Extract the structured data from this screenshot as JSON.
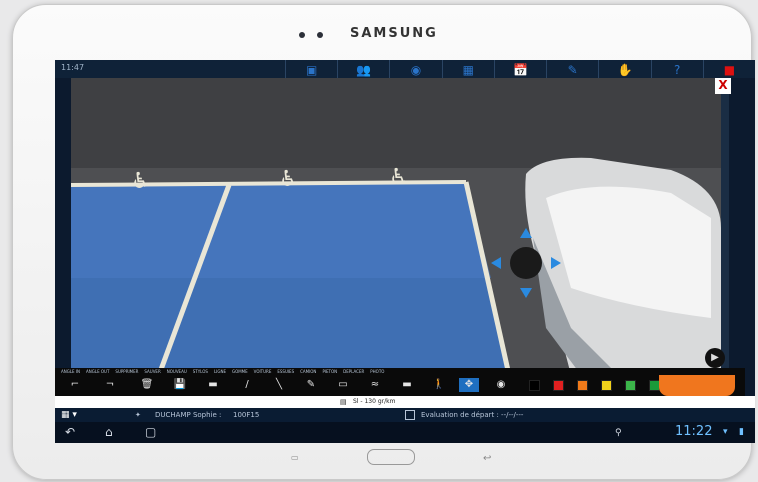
{
  "device": {
    "brand": "SAMSUNG"
  },
  "status_bar": {
    "time": "11:47"
  },
  "top_toolbar": {
    "buttons": [
      {
        "name": "fullscreen",
        "icon": "fullscreen-icon"
      },
      {
        "name": "users",
        "icon": "users-icon"
      },
      {
        "name": "location",
        "icon": "location-icon"
      },
      {
        "name": "plugin",
        "icon": "plugin-icon"
      },
      {
        "name": "calendar",
        "icon": "calendar-icon"
      },
      {
        "name": "pen",
        "icon": "pen-icon"
      },
      {
        "name": "hand",
        "icon": "hand-icon"
      },
      {
        "name": "help",
        "icon": "help-icon"
      },
      {
        "name": "quit",
        "icon": "quit-icon",
        "color": "#d11c1c"
      }
    ]
  },
  "overlay": {
    "close_label": "X"
  },
  "drawing_toolbar": {
    "labels": [
      "ANGLE IN",
      "ANGLE OUT",
      "SUPPRIMER",
      "SAUVER",
      "NOUVEAU",
      "STYLOS",
      "LIGNE",
      "GOMME",
      "VOITURE",
      "ESSUIES",
      "CAMION",
      "PIETON",
      "DEPLACER",
      "PHOTO"
    ],
    "tools": [
      {
        "label": "angle-in",
        "glyph": "⌐"
      },
      {
        "label": "angle-out",
        "glyph": "¬"
      },
      {
        "label": "delete",
        "glyph": "🗑"
      },
      {
        "label": "save",
        "glyph": "💾"
      },
      {
        "label": "new",
        "glyph": "▬"
      },
      {
        "label": "pen",
        "glyph": "/"
      },
      {
        "label": "line",
        "glyph": "╲"
      },
      {
        "label": "eraser",
        "glyph": "✎"
      },
      {
        "label": "car",
        "glyph": "▭"
      },
      {
        "label": "wipers",
        "glyph": "≈"
      },
      {
        "label": "truck",
        "glyph": "▬"
      },
      {
        "label": "pedestrian",
        "glyph": "🚶"
      },
      {
        "label": "move",
        "glyph": "✥"
      },
      {
        "label": "photo",
        "glyph": "◉"
      }
    ],
    "colors": [
      "#000000",
      "#e02020",
      "#f07a1a",
      "#f2d21b",
      "#3bb54a",
      "#1a9a3a",
      "#2f6fd6",
      "#1f3fa8",
      "#ffffff"
    ]
  },
  "info_row": {
    "text": "Sl - 130 gr/km"
  },
  "patient_row": {
    "name": "DUCHAMP Sophie :",
    "id": "100F15",
    "evaluation": "Evaluation de départ : --/--/---"
  },
  "nav_bar": {
    "clock": "11:22"
  }
}
